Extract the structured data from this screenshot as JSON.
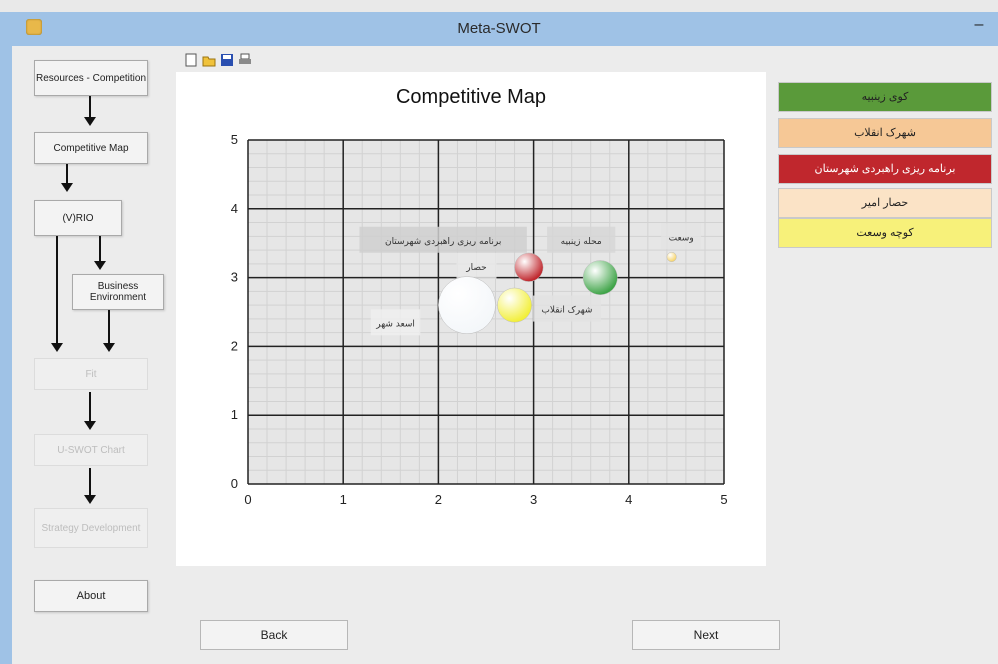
{
  "window": {
    "title": "Meta-SWOT",
    "minimize_label": "–"
  },
  "toolbar": {
    "icons": [
      "new-file-icon",
      "open-folder-icon",
      "save-disk-icon",
      "print-icon"
    ]
  },
  "flow": {
    "resources_competition": "Resources - Competition",
    "competitive_map": "Competitive Map",
    "vrio": "(V)RIO",
    "business_environment": "Business Environment",
    "fit": "Fit",
    "swot_chart": "U-SWOT Chart",
    "strategy_development": "Strategy Development",
    "about": "About"
  },
  "legend": [
    {
      "label": "کوی زینبیه",
      "color": "#5a9a3a"
    },
    {
      "label": "شهرک انقلاب",
      "color": "#f6c896"
    },
    {
      "label": "برنامه ریزی راهبردی شهرستان",
      "color": "#c0272d"
    },
    {
      "label": "حصار امیر",
      "color": "#fbe3c6"
    },
    {
      "label": "کوچه وسعت",
      "color": "#f7f17a"
    }
  ],
  "buttons": {
    "back": "Back",
    "next": "Next"
  },
  "chart_data": {
    "type": "scatter",
    "title": "Competitive Map",
    "xlim": [
      0,
      5
    ],
    "ylim": [
      0,
      5
    ],
    "x_ticks": [
      "0",
      "1",
      "2",
      "3",
      "4",
      "5"
    ],
    "y_ticks": [
      "0",
      "1",
      "2",
      "3",
      "4",
      "5"
    ],
    "grid": true,
    "points": [
      {
        "x": 2.3,
        "y": 2.6,
        "size": 0.3,
        "color": "#f4f7fa"
      },
      {
        "x": 2.8,
        "y": 2.6,
        "size": 0.18,
        "color": "#f2ef3a"
      },
      {
        "x": 2.95,
        "y": 3.15,
        "size": 0.15,
        "color": "#c0272d"
      },
      {
        "x": 3.7,
        "y": 3.0,
        "size": 0.18,
        "color": "#3fa448"
      },
      {
        "x": 4.45,
        "y": 3.3,
        "size": 0.05,
        "color": "#f7d46a"
      }
    ],
    "annotations": [
      {
        "text": "برنامه ریزی راهبردی شهرستان",
        "x": 2.05,
        "y": 3.55,
        "bg": "#cfcfcf"
      },
      {
        "text": "حصار",
        "x": 2.4,
        "y": 3.17,
        "bg": "#e8e8e8"
      },
      {
        "text": "محله زینبیه",
        "x": 3.5,
        "y": 3.55,
        "bg": "#d6d6d6"
      },
      {
        "text": "وسعت",
        "x": 4.55,
        "y": 3.6,
        "bg": "#e3e3e3"
      },
      {
        "text": "اسعد شهر",
        "x": 1.55,
        "y": 2.35,
        "bg": "#eeeeee"
      },
      {
        "text": "شهرک انقلاب",
        "x": 3.35,
        "y": 2.55,
        "bg": "#e2e2e2"
      }
    ]
  }
}
